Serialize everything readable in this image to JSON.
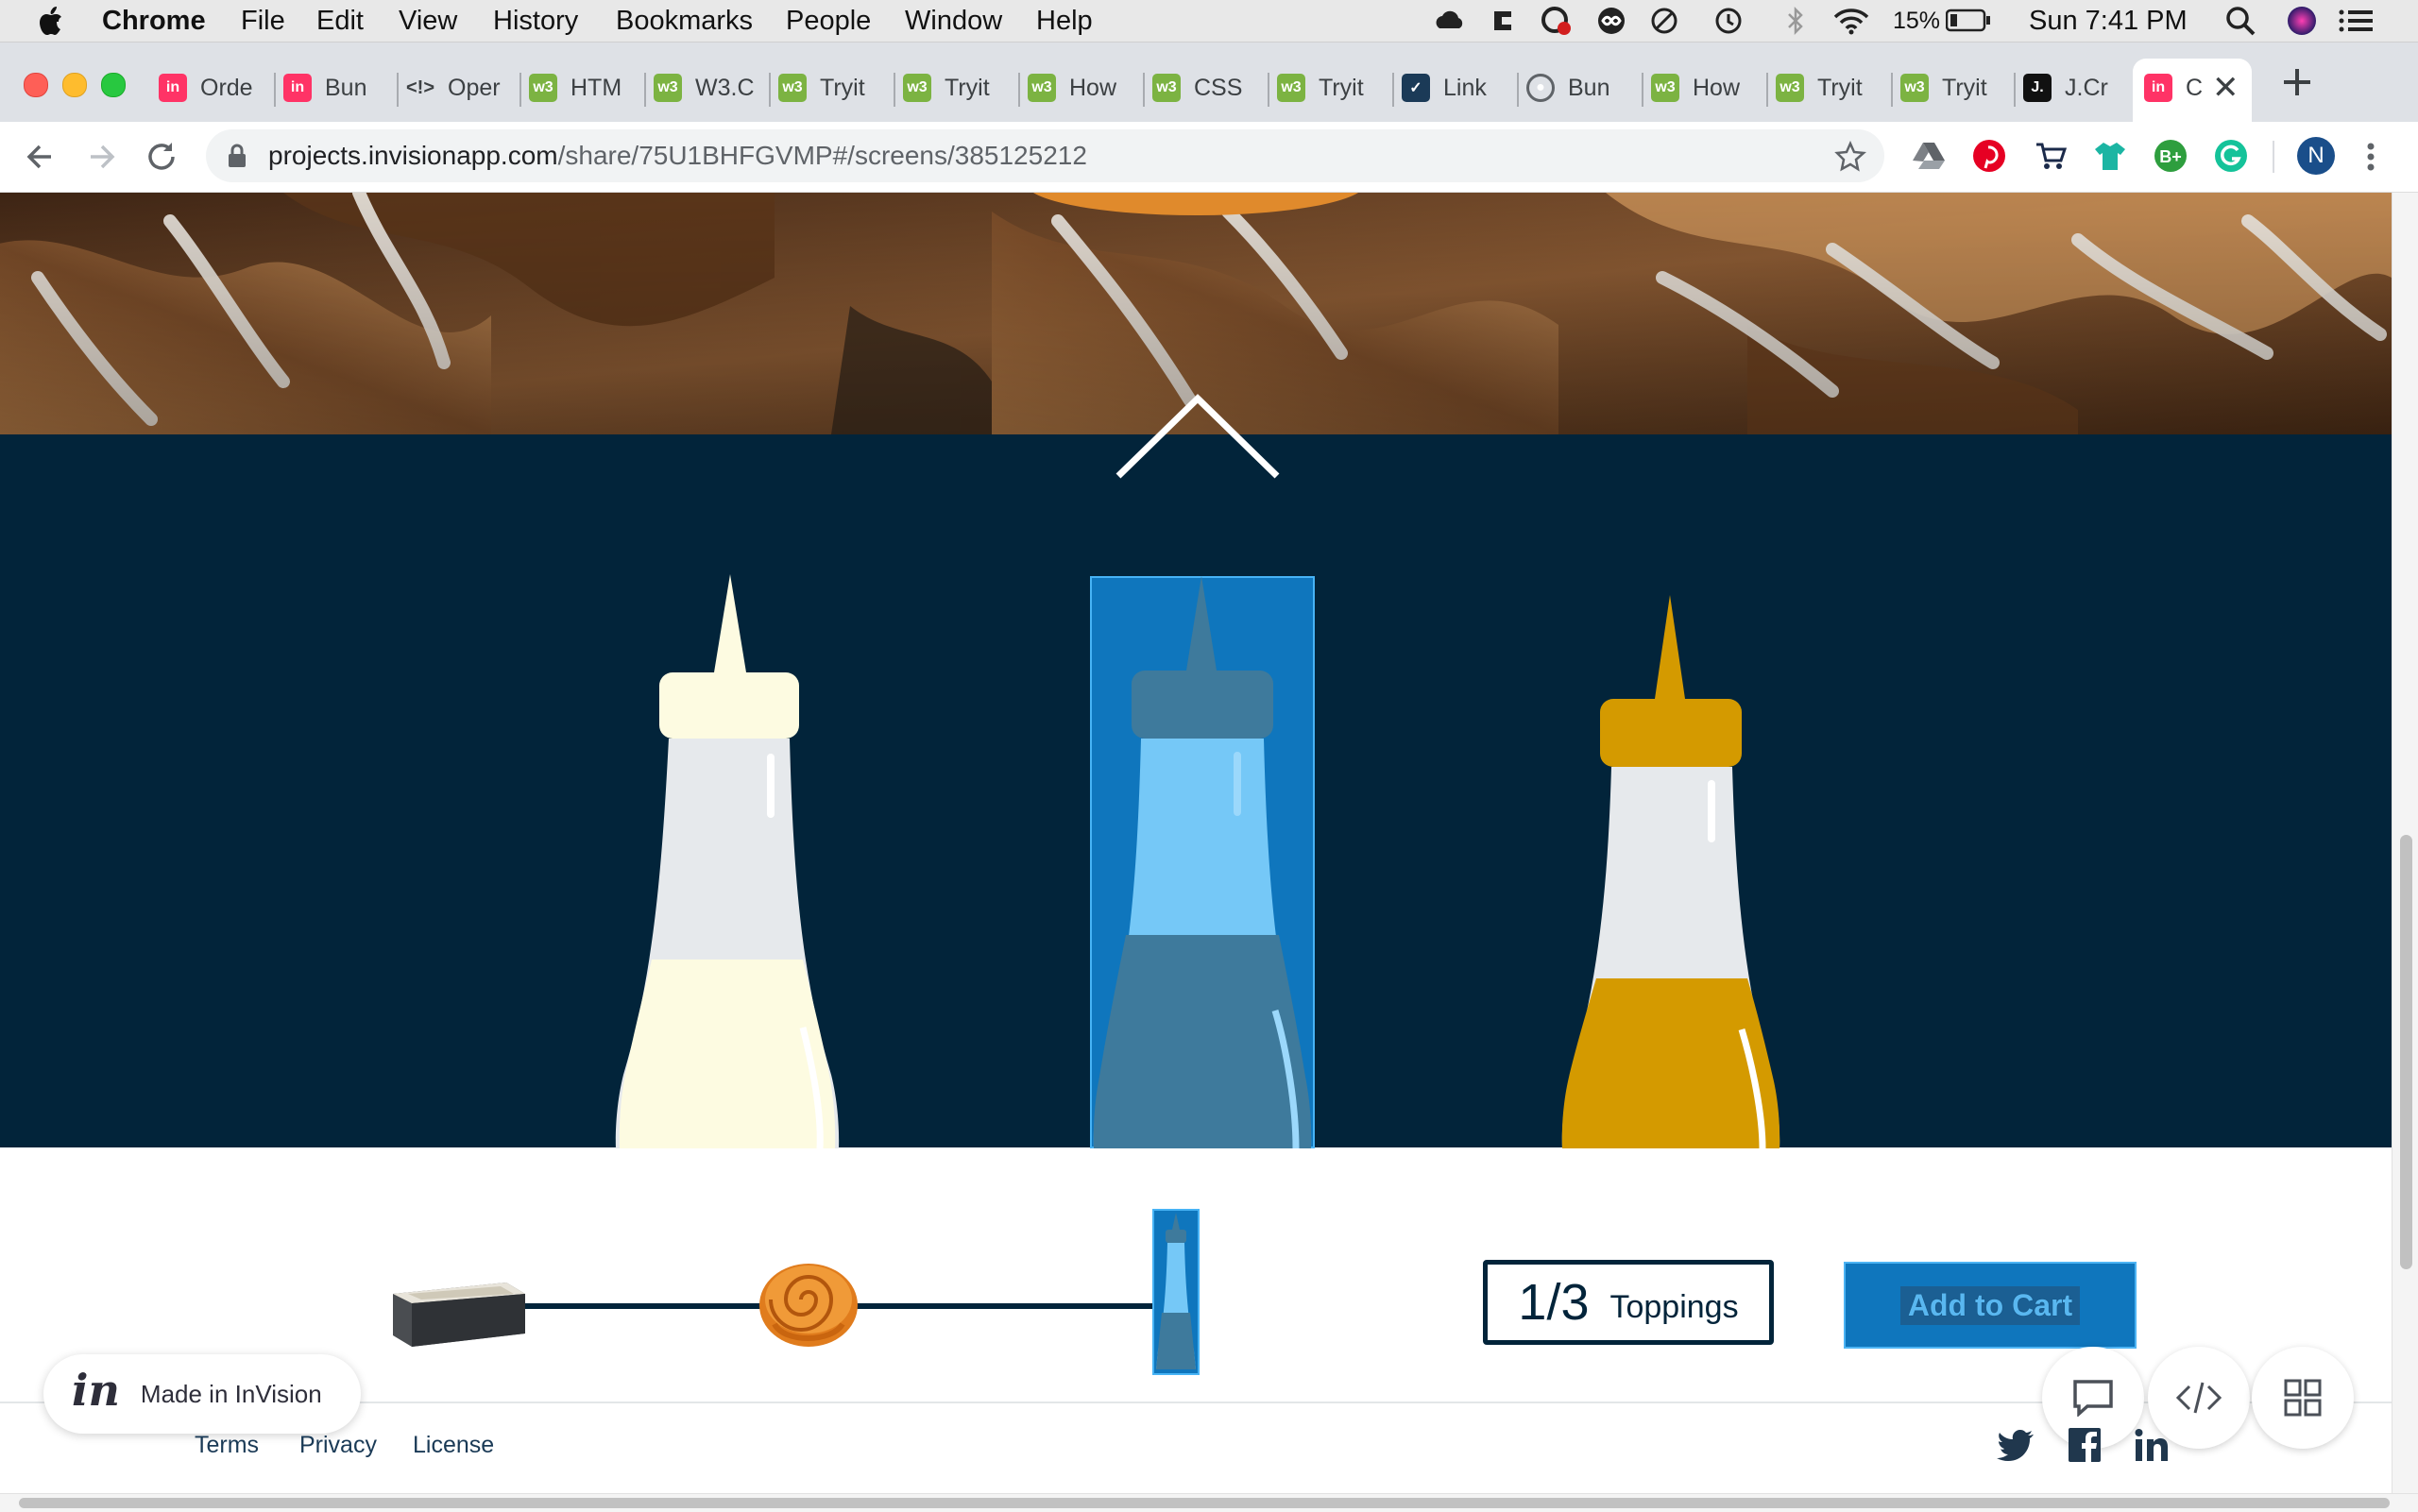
{
  "menubar": {
    "app": "Chrome",
    "items": [
      "File",
      "Edit",
      "View",
      "History",
      "Bookmarks",
      "People",
      "Window",
      "Help"
    ],
    "battery": "15%",
    "clock": "Sun 7:41 PM"
  },
  "tabs": [
    {
      "label": "Orde",
      "icon": "invision-icon",
      "color": "#ff3366"
    },
    {
      "label": "Bun",
      "icon": "invision-icon",
      "color": "#ff3366"
    },
    {
      "label": "Oper",
      "icon": "code-icon",
      "color": "#3c4043"
    },
    {
      "label": "HTM",
      "icon": "w3schools-icon",
      "color": "#7cb342"
    },
    {
      "label": "W3.C",
      "icon": "w3schools-icon",
      "color": "#7cb342"
    },
    {
      "label": "Tryit",
      "icon": "w3schools-icon",
      "color": "#7cb342"
    },
    {
      "label": "Tryit",
      "icon": "w3schools-icon",
      "color": "#7cb342"
    },
    {
      "label": "How",
      "icon": "w3schools-icon",
      "color": "#7cb342"
    },
    {
      "label": "CSS",
      "icon": "w3schools-icon",
      "color": "#7cb342"
    },
    {
      "label": "Tryit",
      "icon": "w3schools-icon",
      "color": "#7cb342"
    },
    {
      "label": "Link",
      "icon": "check-icon",
      "color": "#1b3a57"
    },
    {
      "label": "Bun",
      "icon": "globe-icon",
      "color": "#5f6368"
    },
    {
      "label": "How",
      "icon": "w3schools-icon",
      "color": "#7cb342"
    },
    {
      "label": "Tryit",
      "icon": "w3schools-icon",
      "color": "#7cb342"
    },
    {
      "label": "Tryit",
      "icon": "w3schools-icon",
      "color": "#7cb342"
    },
    {
      "label": "J.Cr",
      "icon": "jcrew-icon",
      "color": "#111111"
    },
    {
      "label": "C",
      "icon": "invision-icon",
      "color": "#ff3366"
    }
  ],
  "address": {
    "domain": "projects.invisionapp.com",
    "path": "/share/75U1BHFGVMP#/screens/385125212"
  },
  "extensions": [
    "drive-icon",
    "pinterest-icon",
    "cart-icon",
    "shirt-icon",
    "b-plus-icon",
    "grammarly-icon"
  ],
  "profile_initial": "N",
  "colors": {
    "navy": "#02243a",
    "mayo": "#fdfbe1",
    "blue_highlight": "#0f76bd",
    "mustard": "#d49a00",
    "add_button": "#0f76bd",
    "invision_pink": "#ff3366"
  },
  "progress": {
    "current": "1/3",
    "label": "Toppings"
  },
  "add_to_cart": "Add to Cart",
  "invision_badge": {
    "logo": "in",
    "text": "Made in InVision"
  },
  "footer": {
    "links": [
      "Terms",
      "Privacy",
      "License"
    ],
    "social": [
      "twitter-icon",
      "facebook-icon",
      "linkedin-icon"
    ]
  },
  "toolbar_icons": [
    "comment-icon",
    "code-icon",
    "grid-icon"
  ]
}
